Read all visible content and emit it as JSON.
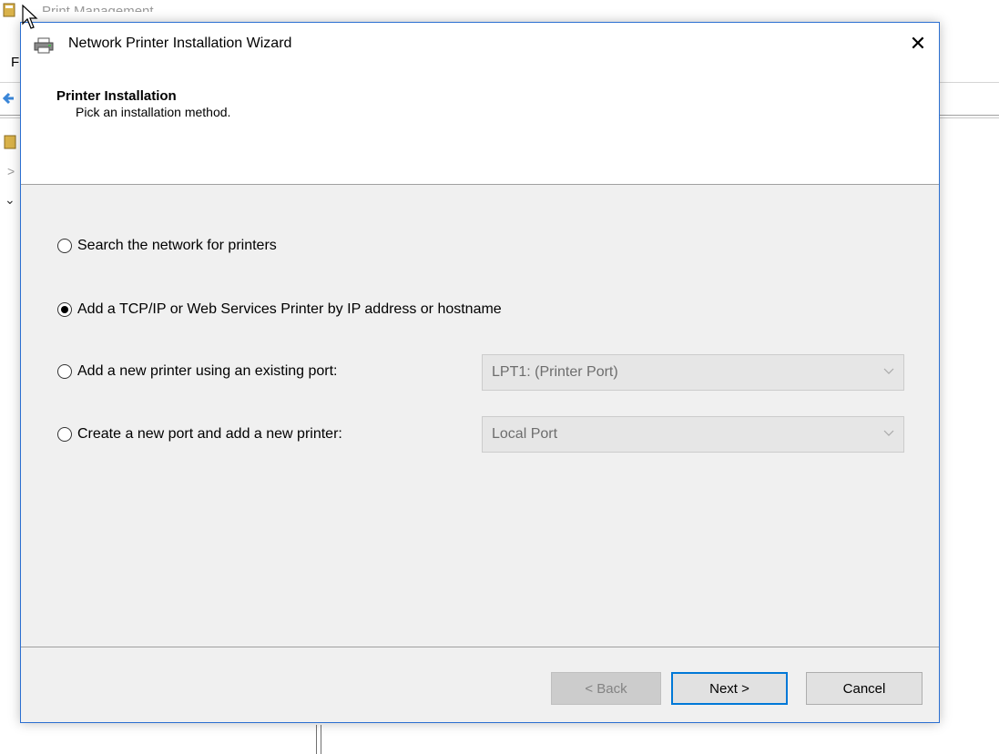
{
  "background_app": {
    "title": "Print Management",
    "menu_partial": "F",
    "tree_expand_glyph": ">",
    "tree_collapse_glyph": "⌄"
  },
  "dialog": {
    "title": "Network Printer Installation Wizard",
    "close_glyph": "✕",
    "icon": "printer-icon",
    "header": {
      "title": "Printer Installation",
      "subtitle": "Pick an installation method."
    },
    "options": [
      {
        "label": "Search the network for printers",
        "selected": false
      },
      {
        "label": "Add a TCP/IP or Web Services Printer by IP address or hostname",
        "selected": true
      },
      {
        "label": "Add a new printer using an existing port:",
        "selected": false
      },
      {
        "label": "Create a new port and add a new printer:",
        "selected": false
      }
    ],
    "existing_port_select": {
      "value": "LPT1: (Printer Port)",
      "enabled": false
    },
    "new_port_select": {
      "value": "Local Port",
      "enabled": false
    },
    "buttons": {
      "back": "< Back",
      "next": "Next >",
      "cancel": "Cancel"
    }
  },
  "colors": {
    "dialog_border": "#2b6fd1",
    "default_button_border": "#0078d7",
    "dialog_body": "#f0f0f0"
  }
}
